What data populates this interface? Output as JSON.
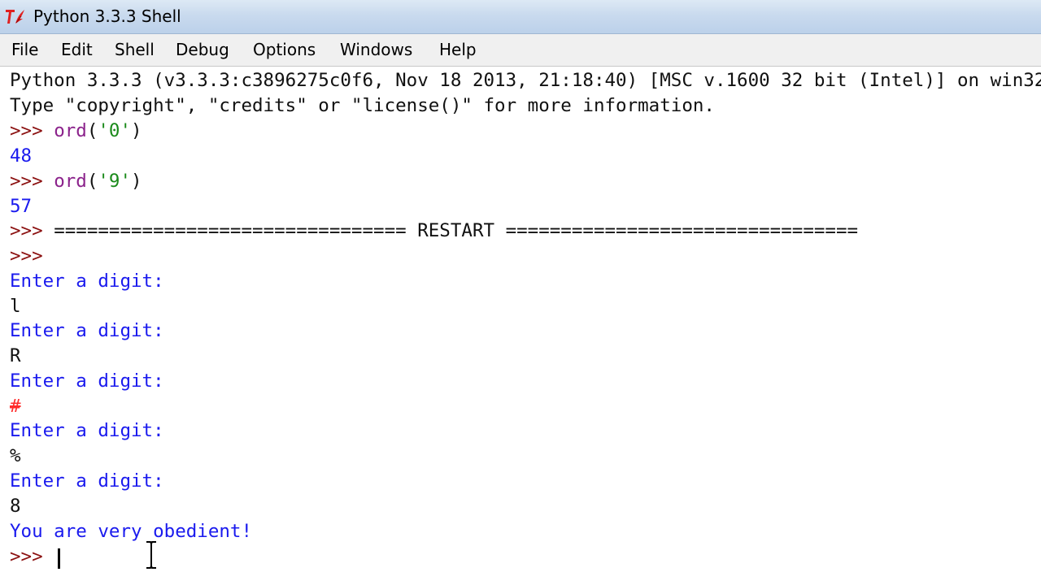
{
  "window": {
    "title": "Python 3.3.3 Shell",
    "icon": "tk-feather-icon"
  },
  "menu": {
    "items": [
      "File",
      "Edit",
      "Shell",
      "Debug",
      "Options",
      "Windows",
      "Help"
    ]
  },
  "shell": {
    "banner_line1": "Python 3.3.3 (v3.3.3:c3896275c0f6, Nov 18 2013, 21:18:40) [MSC v.1600 32 bit (Intel)] on win32",
    "banner_line2": "Type \"copyright\", \"credits\" or \"license()\" for more information.",
    "prompt": ">>> ",
    "cmd1_func": "ord",
    "cmd1_open": "(",
    "cmd1_arg": "'0'",
    "cmd1_close": ")",
    "out1": "48",
    "cmd2_func": "ord",
    "cmd2_open": "(",
    "cmd2_arg": "'9'",
    "cmd2_close": ")",
    "out2": "57",
    "restart": "================================ RESTART ================================",
    "blank_prompt": ">>>",
    "entries": [
      {
        "ask": "Enter a digit:",
        "answer": "l",
        "type": "input"
      },
      {
        "ask": "Enter a digit:",
        "answer": "R",
        "type": "input"
      },
      {
        "ask": "Enter a digit:",
        "answer": "#",
        "type": "stderr"
      },
      {
        "ask": "Enter a digit:",
        "answer": "%",
        "type": "input"
      },
      {
        "ask": "Enter a digit:",
        "answer": "8",
        "type": "input"
      }
    ],
    "final_message": "You are very obedient!",
    "final_prompt": ">>> "
  },
  "colors": {
    "stdout": "#1a1aee",
    "prompt": "#8b1010",
    "builtin": "#8b228b",
    "string": "#1a8a1a",
    "stderr": "#ff2b2b"
  }
}
